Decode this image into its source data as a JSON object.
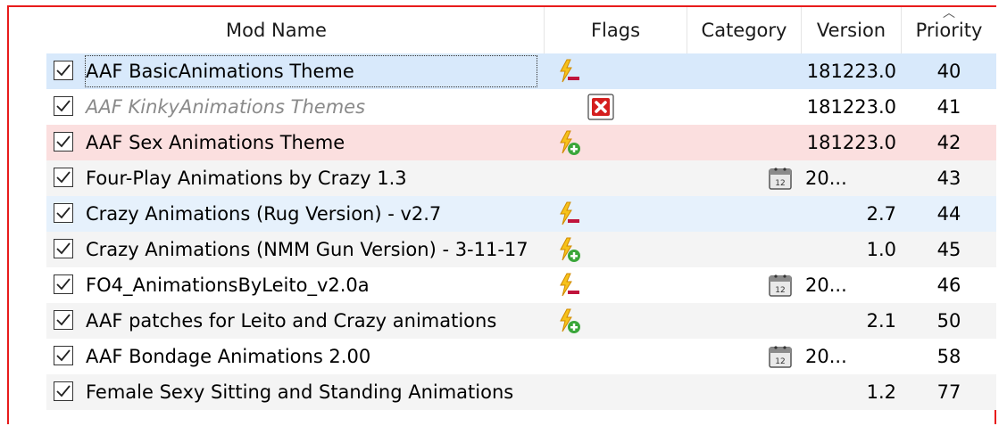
{
  "columns": {
    "mod_name": "Mod Name",
    "flags": "Flags",
    "category": "Category",
    "version": "Version",
    "priority": "Priority"
  },
  "sort_indicator": "^",
  "rows": [
    {
      "name": "AAF BasicAnimations Theme",
      "flag": "lightning-minus",
      "version": "181223.0",
      "priority": "40",
      "style": "blue",
      "checked": true
    },
    {
      "name": "AAF KinkyAnimations Themes",
      "flag": "red-x",
      "version": "181223.0",
      "priority": "41",
      "style": "white",
      "checked": true
    },
    {
      "name": "AAF Sex Animations Theme",
      "flag": "lightning-plus",
      "version": "181223.0",
      "priority": "42",
      "style": "pink",
      "checked": true
    },
    {
      "name": "Four-Play Animations by Crazy 1.3",
      "flag": "",
      "version": "20...",
      "priority": "43",
      "style": "alt",
      "checked": true
    },
    {
      "name": "Crazy Animations (Rug Version) - v2.7",
      "flag": "lightning-minus",
      "version": "2.7",
      "priority": "44",
      "style": "lightblue",
      "checked": true
    },
    {
      "name": "Crazy Animations (NMM Gun Version) - 3-11-17",
      "flag": "lightning-plus",
      "version": "1.0",
      "priority": "45",
      "style": "alt",
      "checked": true
    },
    {
      "name": "FO4_AnimationsByLeito_v2.0a",
      "flag": "lightning-minus",
      "version": "20...",
      "priority": "46",
      "style": "white",
      "checked": true
    },
    {
      "name": "AAF patches for Leito and Crazy animations",
      "flag": "lightning-plus",
      "version": "2.1",
      "priority": "50",
      "style": "alt",
      "checked": true
    },
    {
      "name": "AAF Bondage Animations 2.00",
      "flag": "",
      "version": "20...",
      "priority": "58",
      "style": "white",
      "checked": true
    },
    {
      "name": "Female Sexy Sitting and Standing Animations",
      "flag": "",
      "version": "1.2",
      "priority": "77",
      "style": "alt",
      "checked": true
    }
  ],
  "colors": {
    "selection": "#d8e9fb",
    "conflict_row": "#fbdfdf",
    "frame": "#e81c1c"
  }
}
